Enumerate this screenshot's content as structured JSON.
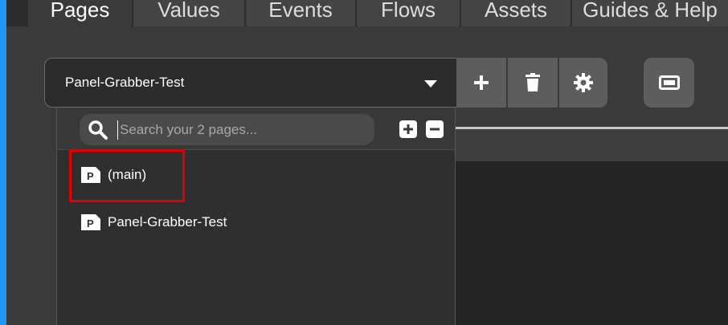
{
  "tabs": [
    {
      "label": "Pages",
      "active": true
    },
    {
      "label": "Values",
      "active": false
    },
    {
      "label": "Events",
      "active": false
    },
    {
      "label": "Flows",
      "active": false
    },
    {
      "label": "Assets",
      "active": false
    },
    {
      "label": "Guides & Help",
      "active": false
    }
  ],
  "page_selector": {
    "selected": "Panel-Grabber-Test",
    "icons": [
      "plus-icon",
      "trash-icon",
      "gear-icon",
      "panel-icon"
    ]
  },
  "dropdown": {
    "search": {
      "placeholder": "Search your 2 pages...",
      "value": ""
    },
    "items": [
      {
        "label": "(main)",
        "icon": "page-icon",
        "highlighted": true
      },
      {
        "label": "Panel-Grabber-Test",
        "icon": "page-icon",
        "highlighted": false
      }
    ]
  },
  "colors": {
    "background": "#3a3a3a",
    "button": "#5d5d5d",
    "highlight": "#e00000",
    "accent_edge": "#2196f3"
  }
}
